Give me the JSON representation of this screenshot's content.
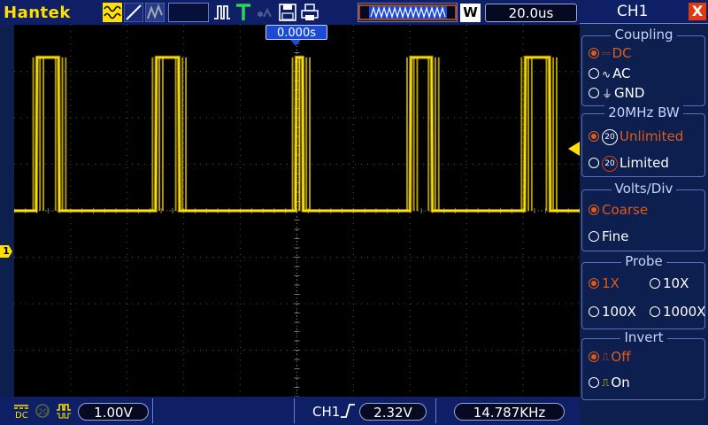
{
  "brand": "Hantek",
  "timebase": "20.0us",
  "timebase_badge": "W",
  "trigger_position": "0.000s",
  "channel_marker": "1",
  "bottom": {
    "volts_div": "1.00V",
    "trigger_channel": "CH1",
    "trigger_level": "2.32V",
    "frequency": "14.787KHz"
  },
  "panel": {
    "title": "CH1",
    "close": "X",
    "coupling": {
      "label": "Coupling",
      "options": [
        "DC",
        "AC",
        "GND"
      ],
      "selected": "DC"
    },
    "bw": {
      "label": "20MHz BW",
      "options": [
        "Unlimited",
        "Limited"
      ],
      "selected": "Unlimited"
    },
    "volts_div": {
      "label": "Volts/Div",
      "options": [
        "Coarse",
        "Fine"
      ],
      "selected": "Coarse"
    },
    "probe": {
      "label": "Probe",
      "options": [
        "1X",
        "10X",
        "100X",
        "1000X"
      ],
      "selected": "1X"
    },
    "invert": {
      "label": "Invert",
      "options": [
        "Off",
        "On"
      ],
      "selected": "Off"
    }
  },
  "colors": {
    "trace": "#ffe000",
    "accent": "#1b4bd6",
    "selected_option": "#e05a14"
  },
  "chart_data": {
    "type": "line",
    "title": "",
    "xlabel": "",
    "ylabel": "",
    "x_unit": "us",
    "x_range": [
      -100,
      100
    ],
    "y_unit": "V",
    "y_range": [
      -4.0,
      4.0
    ],
    "grid": true,
    "series": [
      {
        "x": [
          -100,
          -92.2,
          -91.9,
          -84.3,
          -84.0,
          -84.0,
          -50.0,
          -49.7,
          -41.8,
          -41.5,
          -41.5,
          -0.5,
          -0.2,
          2.0,
          2.3,
          2.3,
          40.0,
          40.3,
          47.6,
          47.9,
          47.9,
          80.5,
          80.8,
          89.3,
          89.6,
          89.6,
          100
        ],
        "y": [
          0,
          0,
          3.3,
          3.3,
          0,
          0,
          0,
          3.3,
          3.3,
          0,
          0,
          0,
          3.3,
          3.3,
          0,
          0,
          0,
          3.3,
          3.3,
          0,
          0,
          0,
          3.3,
          3.3,
          0,
          0,
          0
        ]
      }
    ]
  }
}
